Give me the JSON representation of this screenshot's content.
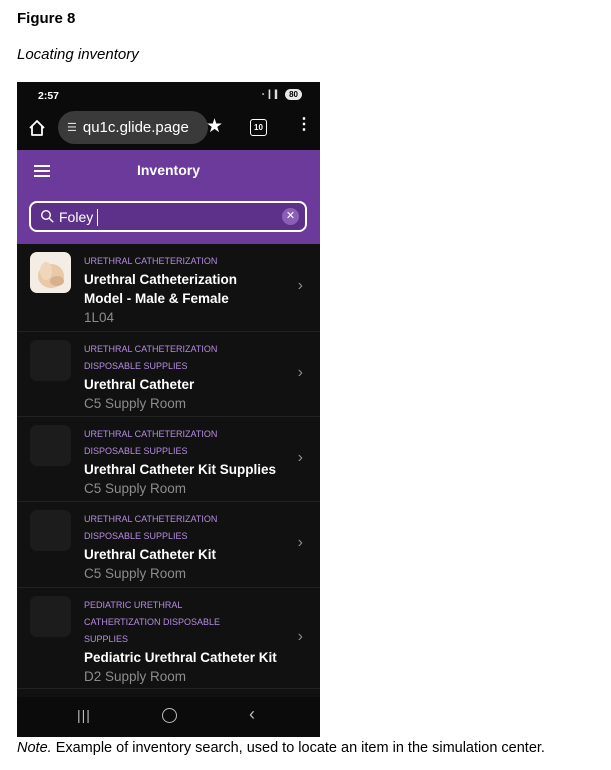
{
  "figure": {
    "label": "Figure 8",
    "title": "Locating inventory",
    "note_prefix": "Note.",
    "note_text": " Example of inventory search, used to locate an item in the simulation center."
  },
  "status_bar": {
    "time": "2:57",
    "battery": "80"
  },
  "browser": {
    "url": "qu1c.glide.page",
    "tab_count": "10"
  },
  "app": {
    "title": "Inventory",
    "search_value": "Foley",
    "accent_color": "#6b3a9a"
  },
  "results": [
    {
      "categories": [
        "URETHRAL CATHETERIZATION"
      ],
      "name_lines": [
        "Urethral Catheterization",
        "Model - Male & Female"
      ],
      "location": "1L04",
      "has_image": true
    },
    {
      "categories": [
        "URETHRAL CATHETERIZATION",
        "DISPOSABLE SUPPLIES"
      ],
      "name_lines": [
        "Urethral Catheter"
      ],
      "location": "C5 Supply Room",
      "has_image": false
    },
    {
      "categories": [
        "URETHRAL CATHETERIZATION",
        "DISPOSABLE SUPPLIES"
      ],
      "name_lines": [
        "Urethral Catheter Kit Supplies"
      ],
      "location": "C5 Supply Room",
      "has_image": false
    },
    {
      "categories": [
        "URETHRAL CATHETERIZATION",
        "DISPOSABLE SUPPLIES"
      ],
      "name_lines": [
        "Urethral Catheter Kit"
      ],
      "location": "C5 Supply Room",
      "has_image": false
    },
    {
      "categories": [
        "PEDIATRIC URETHRAL",
        "CATHERTIZATION DISPOSABLE",
        "SUPPLIES"
      ],
      "name_lines": [
        "Pediatric Urethral Catheter Kit"
      ],
      "location": "D2 Supply Room",
      "has_image": false
    }
  ]
}
